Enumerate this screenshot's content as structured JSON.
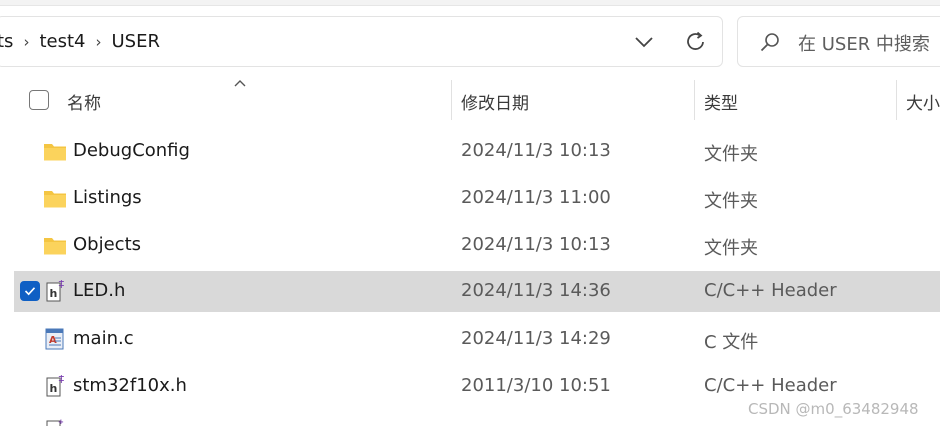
{
  "breadcrumb": {
    "items": [
      "ts",
      "test4",
      "USER"
    ],
    "separator": "›"
  },
  "search": {
    "placeholder": "在 USER 中搜索"
  },
  "columns": {
    "name": "名称",
    "modified": "修改日期",
    "type": "类型",
    "size": "大小"
  },
  "files": [
    {
      "name": "DebugConfig",
      "modified": "2024/11/3 10:13",
      "type": "文件夹",
      "icon": "folder-icon",
      "selected": false
    },
    {
      "name": "Listings",
      "modified": "2024/11/3 11:00",
      "type": "文件夹",
      "icon": "folder-icon",
      "selected": false
    },
    {
      "name": "Objects",
      "modified": "2024/11/3 10:13",
      "type": "文件夹",
      "icon": "folder-icon",
      "selected": false
    },
    {
      "name": "LED.h",
      "modified": "2024/11/3 14:36",
      "type": "C/C++ Header",
      "icon": "header-file-icon",
      "selected": true
    },
    {
      "name": "main.c",
      "modified": "2024/11/3 14:29",
      "type": "C 文件",
      "icon": "c-file-icon",
      "selected": false
    },
    {
      "name": "stm32f10x.h",
      "modified": "2011/3/10 10:51",
      "type": "C/C++ Header",
      "icon": "header-file-icon",
      "selected": false
    }
  ],
  "watermark": "CSDN @m0_63482948",
  "colors": {
    "selection": "#d9d9d9",
    "checkbox_accent": "#0f5fc4",
    "folder": "#f4c542"
  }
}
